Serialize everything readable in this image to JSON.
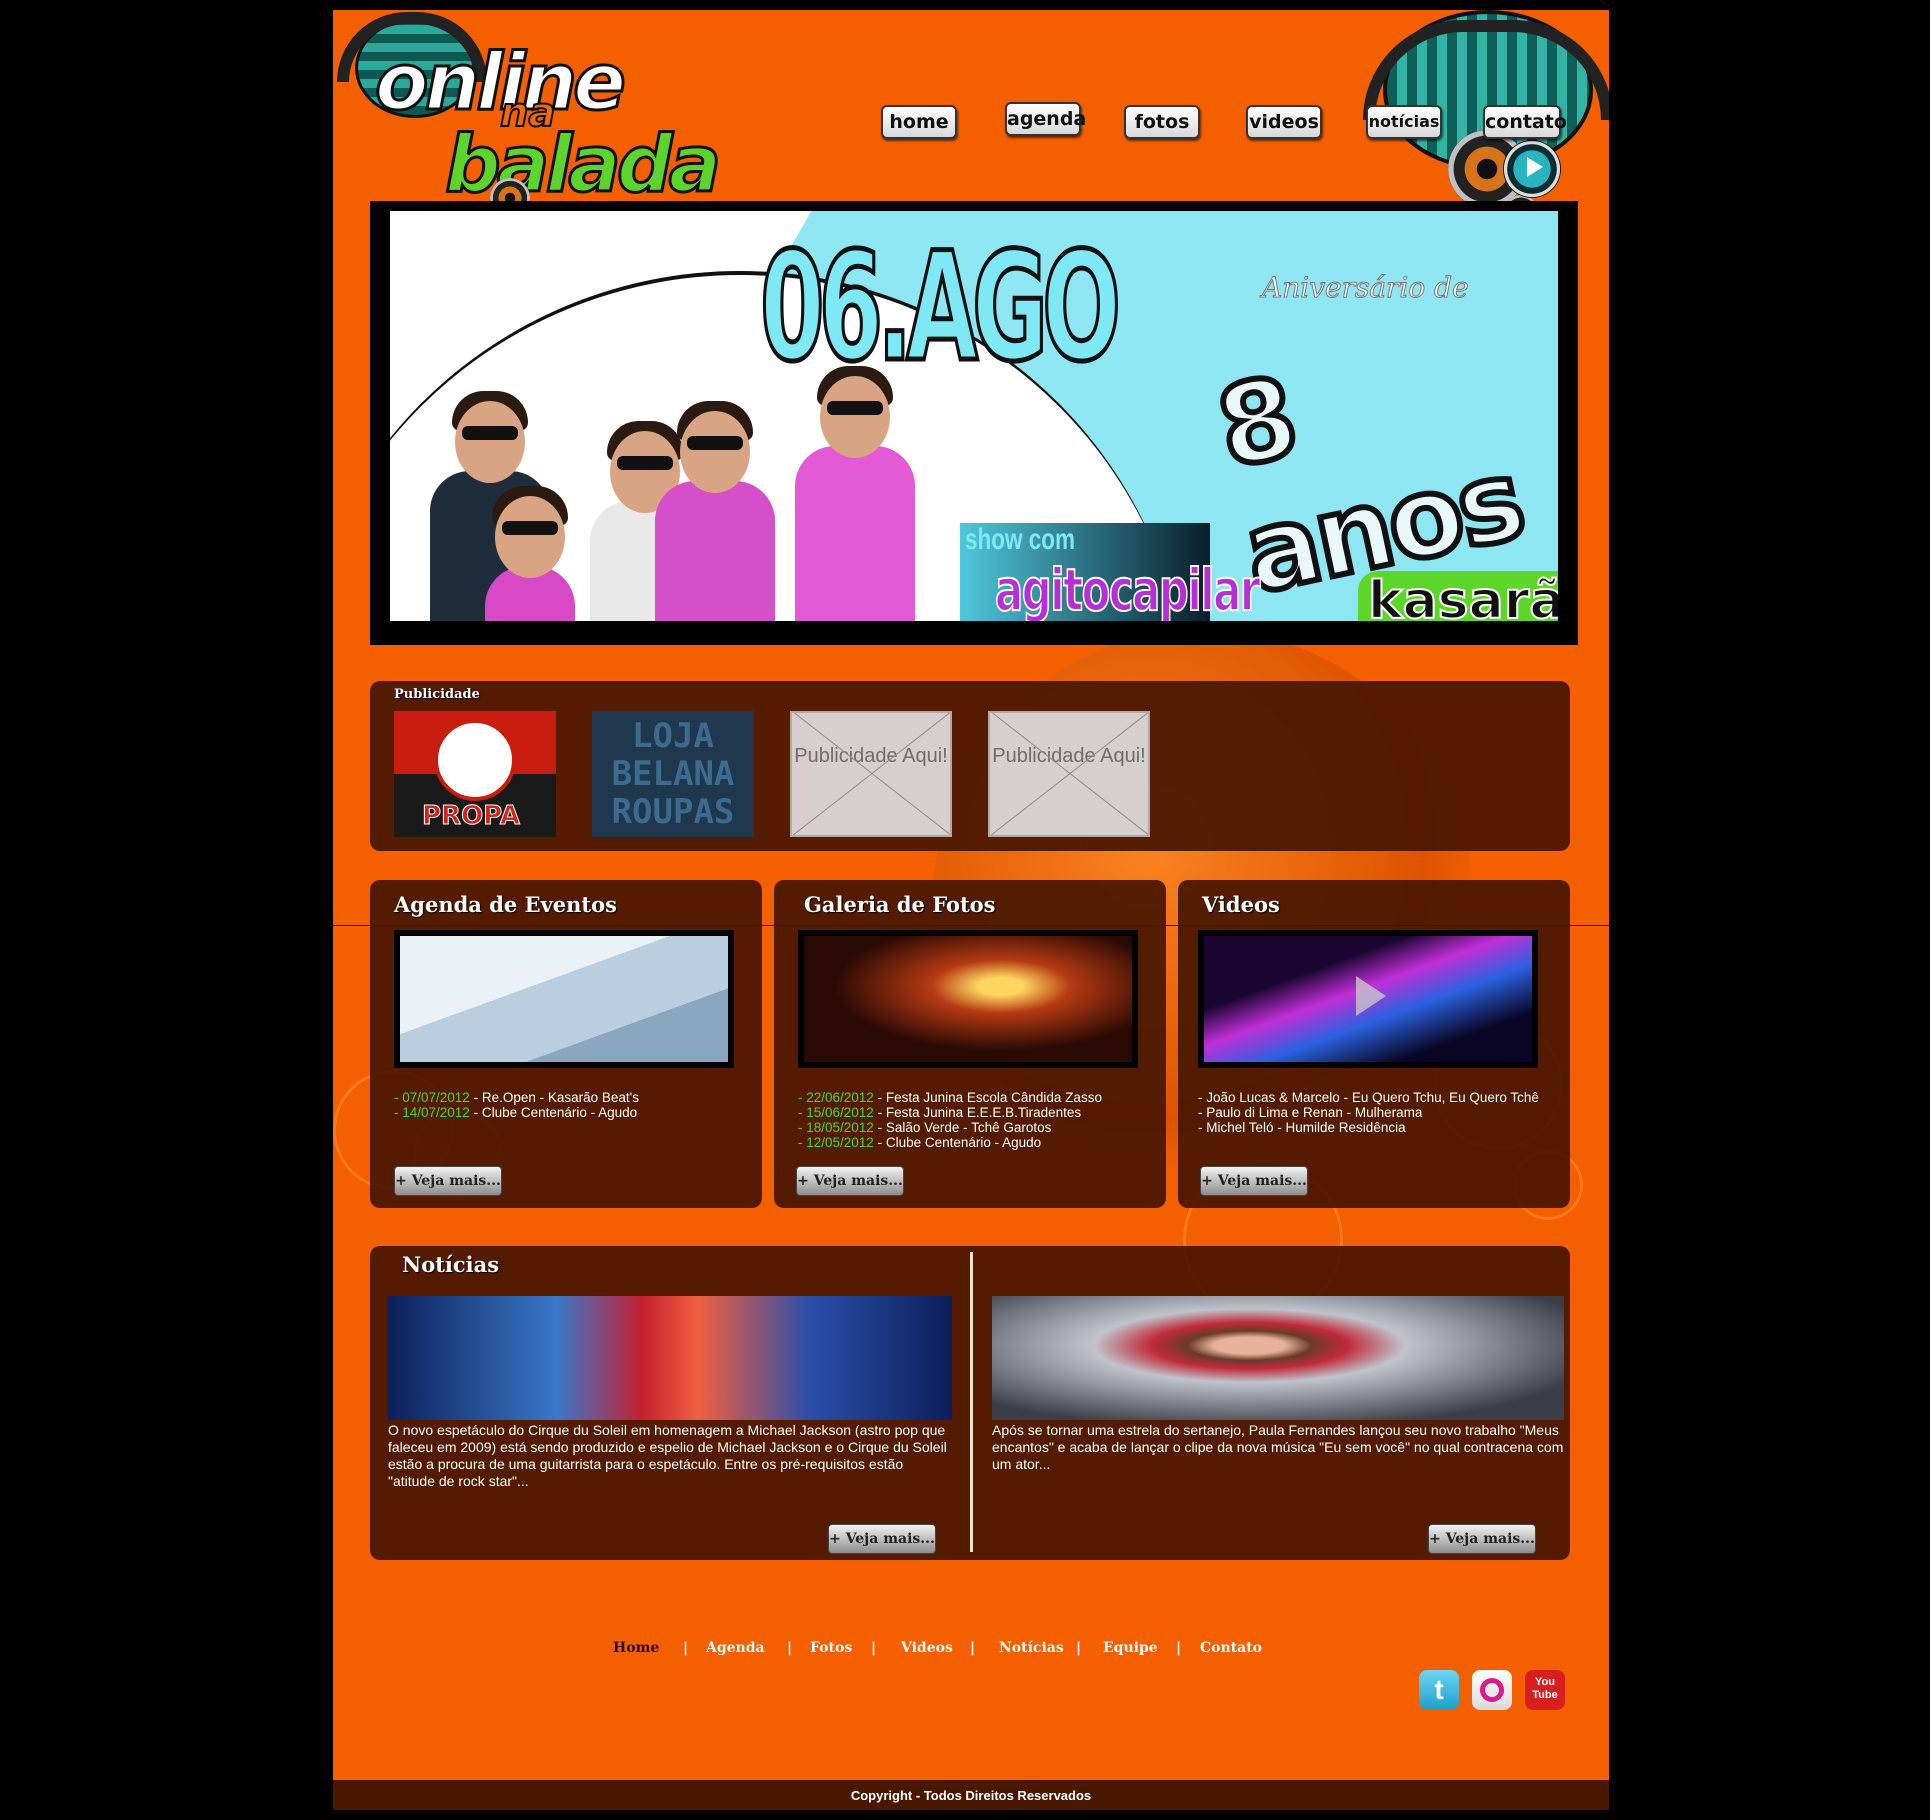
{
  "logo": {
    "word1": "online",
    "word2": "na",
    "word3": "balada"
  },
  "nav": [
    "home",
    "agenda",
    "fotos",
    "videos",
    "notícias",
    "contato"
  ],
  "banner": {
    "date": "06.AGO",
    "subtitle": "Aniversário de",
    "years": "8 anos",
    "show": "show com",
    "band": "agitocapilar",
    "club": "kasarão"
  },
  "ads": {
    "title": "Publicidade",
    "propa": "PROPA",
    "belana": "LOJA BELANA ROUPAS",
    "placeholder1": "Publicidade Aqui!",
    "placeholder2": "Publicidade Aqui!"
  },
  "agenda": {
    "title": "Agenda de Eventos",
    "items": [
      {
        "date": "07/07/2012",
        "text": "Re.Open - Kasarão Beat's"
      },
      {
        "date": "14/07/2012",
        "text": "Clube Centenário - Agudo"
      }
    ],
    "more": "+ Veja mais..."
  },
  "gallery": {
    "title": "Galeria de Fotos",
    "items": [
      {
        "date": "22/06/2012",
        "text": "Festa Junina Escola Cândida Zasso"
      },
      {
        "date": "15/06/2012",
        "text": "Festa Junina E.E.E.B.Tiradentes"
      },
      {
        "date": "18/05/2012",
        "text": "Salão Verde - Tchê Garotos"
      },
      {
        "date": "12/05/2012",
        "text": "Clube Centenário - Agudo"
      }
    ],
    "more": "+ Veja mais..."
  },
  "videos": {
    "title": "Videos",
    "items": [
      "João Lucas & Marcelo - Eu Quero Tchu, Eu Quero Tchê",
      "Paulo di Lima e Renan - Mulherama",
      "Michel Teló - Humilde Residência"
    ],
    "more": "+ Veja mais..."
  },
  "news": {
    "title": "Notícias",
    "items": [
      {
        "text": "O novo espetáculo do Cirque du Soleil em homenagem a Michael Jackson (astro pop que faleceu em 2009) está sendo produzido e espelio de Michael Jackson e o Cirque du Soleil estão a procura de uma guitarrista para o espetáculo. Entre os pré-requisitos estão \"atitude de rock star\"...",
        "more": "+ Veja mais..."
      },
      {
        "text": "Após se tornar uma estrela do sertanejo, Paula Fernandes lançou seu novo trabalho \"Meus encantos\" e acaba de lançar o clipe da nova música \"Eu sem você\" no qual contracena com um ator...",
        "more": "+ Veja mais..."
      }
    ]
  },
  "footer": {
    "links": [
      "Home",
      "Agenda",
      "Fotos",
      "Videos",
      "Notícias",
      "Equipe",
      "Contato"
    ],
    "separator": "|",
    "social": [
      "twitter-icon",
      "orkut-icon",
      "youtube-icon"
    ],
    "youtube_label": "You Tube",
    "copyright": "Copyright - Todos Direitos Reservados"
  },
  "colors": {
    "background": "#f45f00",
    "panel": "#461600",
    "date_green": "#4cd928"
  }
}
